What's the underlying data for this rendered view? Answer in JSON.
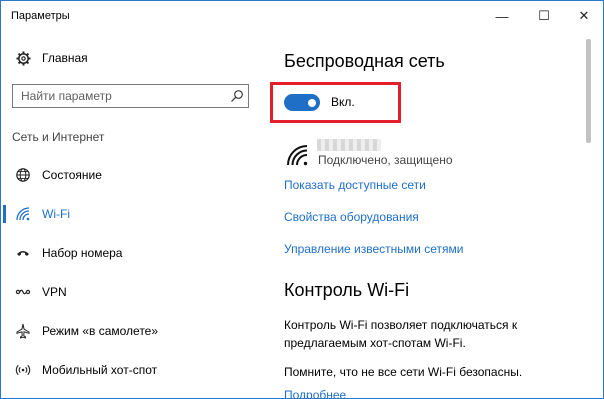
{
  "window": {
    "title": "Параметры",
    "controls": {
      "minimize": "—",
      "maximize": "☐",
      "close": "✕"
    }
  },
  "sidebar": {
    "home": {
      "label": "Главная",
      "icon": "gear-icon"
    },
    "search": {
      "placeholder": "Найти параметр",
      "icon": "search-icon"
    },
    "section_label": "Сеть и Интернет",
    "items": [
      {
        "label": "Состояние",
        "icon": "globe-icon",
        "active": false
      },
      {
        "label": "Wi-Fi",
        "icon": "wifi-icon",
        "active": true
      },
      {
        "label": "Набор номера",
        "icon": "phone-icon",
        "active": false
      },
      {
        "label": "VPN",
        "icon": "vpn-icon",
        "active": false
      },
      {
        "label": "Режим «в самолете»",
        "icon": "airplane-icon",
        "active": false
      },
      {
        "label": "Мобильный хот-спот",
        "icon": "hotspot-icon",
        "active": false
      }
    ]
  },
  "main": {
    "wireless_title": "Беспроводная сеть",
    "toggle": {
      "state": "on",
      "label": "Вкл."
    },
    "network": {
      "status": "Подключено, защищено"
    },
    "links": [
      "Показать доступные сети",
      "Свойства оборудования",
      "Управление известными сетями"
    ],
    "wifi_control_title": "Контроль Wi-Fi",
    "wifi_control_text": "Контроль Wi-Fi позволяет подключаться к предлагаемым хот-спотам Wi-Fi.",
    "note_text": "Помните, что не все сети Wi-Fi безопасны.",
    "more_link": "Подробнее"
  },
  "colors": {
    "accent": "#1f6fc7",
    "highlight_border": "#e21f2a",
    "window_border": "#2b78c9"
  }
}
